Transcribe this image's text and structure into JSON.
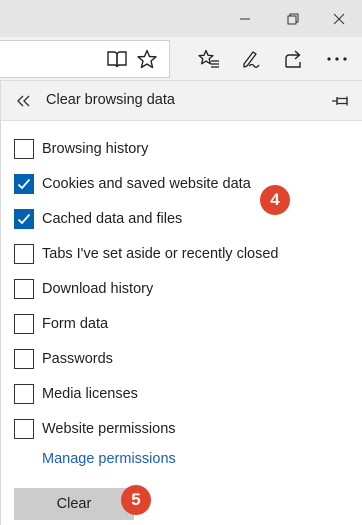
{
  "window": {
    "controls": [
      {
        "name": "minimize-icon"
      },
      {
        "name": "restore-icon"
      },
      {
        "name": "close-icon"
      }
    ]
  },
  "toolbar": {
    "icons": [
      "reading-view-icon",
      "favorite-star-icon",
      "favorites-hub-icon",
      "pen-icon",
      "share-icon",
      "more-icon"
    ]
  },
  "panel": {
    "title": "Clear browsing data",
    "options": [
      {
        "label": "Browsing history",
        "checked": false
      },
      {
        "label": "Cookies and saved website data",
        "checked": true
      },
      {
        "label": "Cached data and files",
        "checked": true
      },
      {
        "label": "Tabs I've set aside or recently closed",
        "checked": false
      },
      {
        "label": "Download history",
        "checked": false
      },
      {
        "label": "Form data",
        "checked": false
      },
      {
        "label": "Passwords",
        "checked": false
      },
      {
        "label": "Media licenses",
        "checked": false
      },
      {
        "label": "Website permissions",
        "checked": false
      }
    ],
    "manage_link": "Manage permissions",
    "clear_label": "Clear"
  },
  "annotations": {
    "step_cookies": "4",
    "step_clear": "5"
  },
  "colors": {
    "accent": "#0063b1",
    "badge": "#e0442c",
    "link": "#1a5fb4"
  }
}
